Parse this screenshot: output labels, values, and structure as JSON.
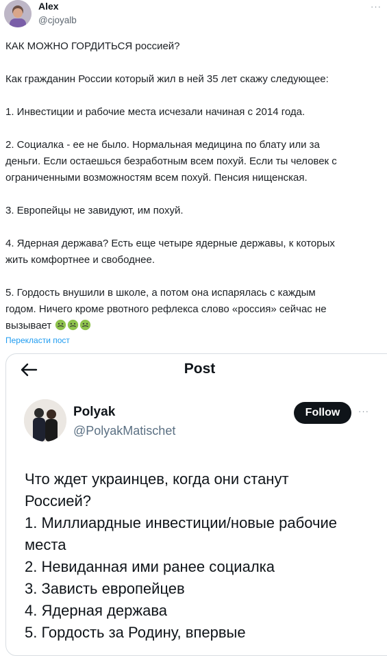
{
  "author": {
    "name": "Alex",
    "handle": "@cjoyalb"
  },
  "tweet": {
    "paragraphs": [
      "КАК МОЖНО ГОРДИТЬСЯ россией?",
      "Как гражданин России который жил в ней 35 лет скажу следующее:",
      "1. Инвестиции и рабочие места исчезали начиная с 2014 года.",
      "2. Социалка - ее не было. Нормальная медицина по блату или за\nденьги. Если остаешься безработным всем похуй. Если ты человек с\nограниченными возможностям всем похуй. Пенсия нищенская.",
      "3. Европейцы не завидуют, им похуй.",
      "4. Ядерная держава? Есть еще четыре ядерные державы, к которых\nжить комфортнее и свободнее.",
      "5. Гордость внушили в школе, а потом она испарялась с каждым\nгодом. Ничего кроме рвотного рефлекса слово «россия» сейчас не\nвызывает"
    ],
    "emoji": "nauseated-face-emoji",
    "translate_label": "Перекласти пост"
  },
  "quote": {
    "header_title": "Post",
    "author_name": "Polyak",
    "author_handle": "@PolyakMatischet",
    "follow_label": "Follow",
    "lines": [
      "Что ждет украинцев, когда они станут",
      "Россией?",
      "1. Миллиардные инвестиции/новые рабочие",
      "места",
      "2. Невиданная ими ранее социалка",
      "3. Зависть европейцев",
      "4. Ядерная держава",
      "5. Гордость за Родину, впервые"
    ]
  },
  "colors": {
    "link": "#1d9bf0",
    "muted": "#5c6670",
    "follow_bg": "#0f1419"
  }
}
